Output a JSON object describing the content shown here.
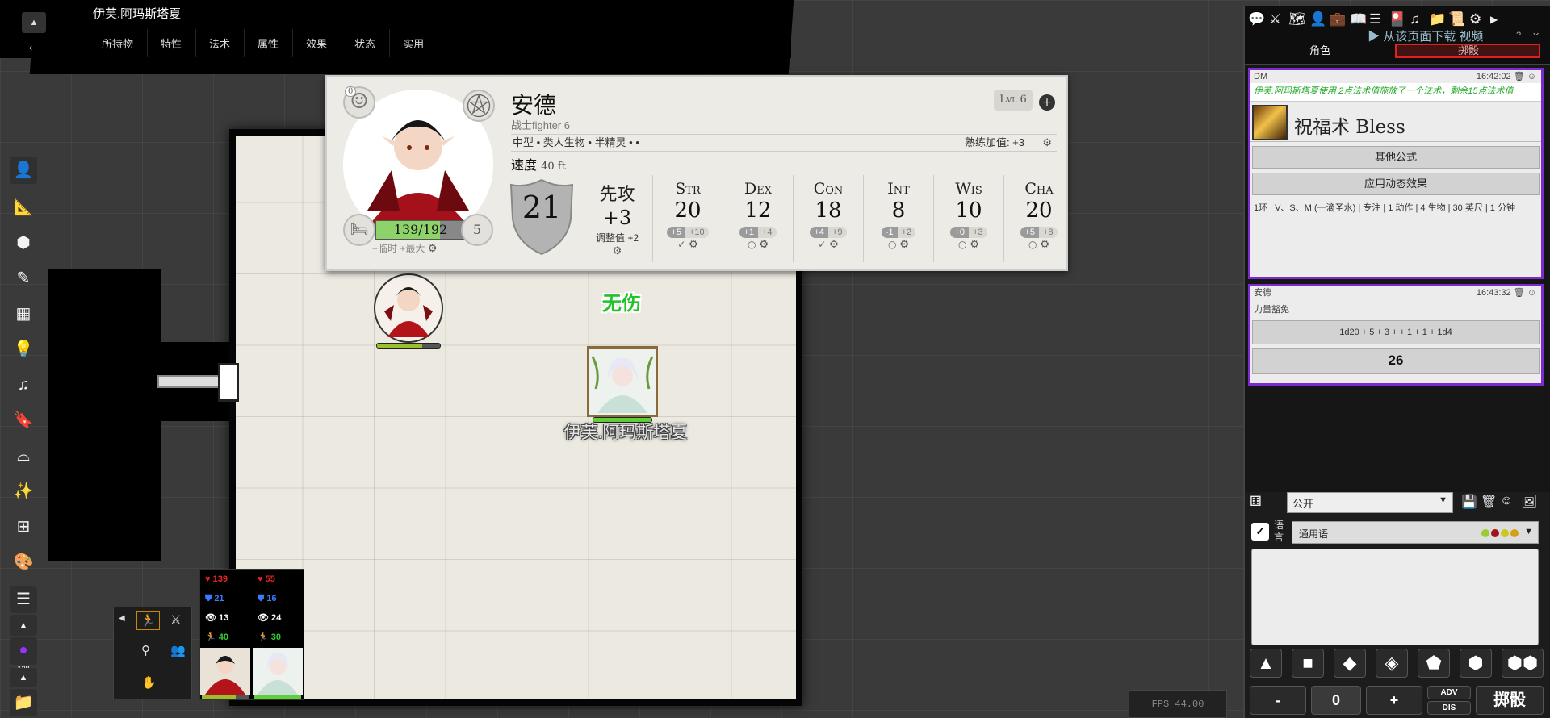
{
  "window": {
    "character_name": "伊芙.阿玛斯塔夏"
  },
  "topbar": {
    "tabs": [
      "所持物",
      "特性",
      "法术",
      "属性",
      "效果",
      "状态",
      "实用"
    ]
  },
  "map": {
    "floating_text": "无伤",
    "selected_token_name": "伊芙.阿玛斯塔夏",
    "token_imas_hp_fraction": 1.0,
    "token_ande_hp_fraction": 0.72
  },
  "sheet": {
    "name": "安德",
    "class": "战士fighter 6",
    "level": "Lvl 6",
    "traits": "中型 • 类人生物 • 半精灵 • •",
    "proficiency": "熟练加值: +3",
    "speed_label": "速度",
    "speed_value": "40 ft",
    "ac": "21",
    "inspiration": "0",
    "hp": "139/192",
    "hp_fraction": 0.72,
    "hit_dice": "5",
    "temp_max": "+临时 +最大",
    "initiative": {
      "label": "先攻",
      "value": "+3",
      "adjust_label": "调整值",
      "adjust_value": "+2"
    },
    "abilities": [
      {
        "label": "Str",
        "score": "20",
        "mod": "+5",
        "save": "+10",
        "proficient": true
      },
      {
        "label": "Dex",
        "score": "12",
        "mod": "+1",
        "save": "+4",
        "proficient": false
      },
      {
        "label": "Con",
        "score": "18",
        "mod": "+4",
        "save": "+9",
        "proficient": true
      },
      {
        "label": "Int",
        "score": "8",
        "mod": "-1",
        "save": "+2",
        "proficient": false
      },
      {
        "label": "Wis",
        "score": "10",
        "mod": "+0",
        "save": "+3",
        "proficient": false
      },
      {
        "label": "Cha",
        "score": "20",
        "mod": "+5",
        "save": "+8",
        "proficient": false
      }
    ]
  },
  "sidebar": {
    "tabs": {
      "character": "角色",
      "roll": "掷骰"
    },
    "download_overlay": "从该页面下载 视频"
  },
  "chat": {
    "msg1": {
      "sender": "DM",
      "time": "16:42:02",
      "note": "伊芙.阿玛斯塔夏使用 2点法术值施放了一个法术，剩余15点法术值.",
      "spell_name": "祝福术 Bless",
      "button_formula": "其他公式",
      "button_effect": "应用动态效果",
      "props": "1环 | V、S、M (一滴圣水) | 专注 | 1 动作 | 4 生物 | 30 英尺 | 1 分钟"
    },
    "msg2": {
      "sender": "安德",
      "time": "16:43:32",
      "title": "力量豁免",
      "formula": "1d20 + 5 + 3 + + 1 + 1 + 1d4",
      "result": "26"
    },
    "visibility": "公开",
    "language_label": "语言",
    "language": "通用语",
    "language_dot_colors": [
      "#9acd32",
      "#a0141e",
      "#c8c81e",
      "#d4a017"
    ]
  },
  "dice": {
    "minus": "-",
    "value": "0",
    "plus": "+",
    "adv": "ADV",
    "dis": "DIS",
    "roll": "掷骰"
  },
  "party": {
    "members": [
      {
        "hp": "139",
        "ac": "21",
        "perception": "13",
        "speed": "40",
        "hp_fraction": 0.72
      },
      {
        "hp": "55",
        "ac": "16",
        "perception": "24",
        "speed": "30",
        "hp_fraction": 1.0
      }
    ]
  },
  "toolbar": {
    "counter": "128"
  },
  "fps": "FPS  44.00"
}
